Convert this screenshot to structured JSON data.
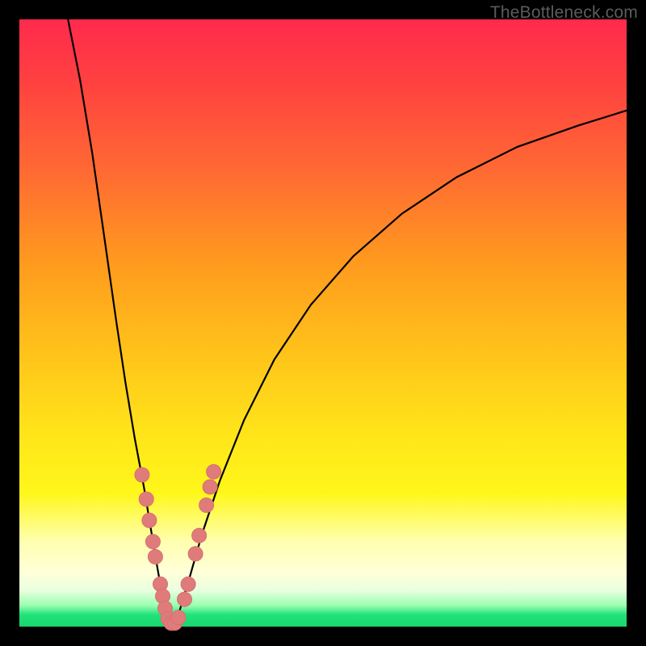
{
  "watermark": "TheBottleneck.com",
  "colors": {
    "frame": "#000000",
    "curve": "#000000",
    "marker_fill": "#e07b7b",
    "marker_stroke": "#d86f6f"
  },
  "chart_data": {
    "type": "line",
    "title": "",
    "xlabel": "",
    "ylabel": "",
    "xlim": [
      0,
      100
    ],
    "ylim": [
      0,
      100
    ],
    "grid": false,
    "legend": false,
    "series": [
      {
        "name": "left-branch",
        "x": [
          8,
          10,
          12,
          14,
          16,
          17.5,
          19,
          20.5,
          21.5,
          22.5,
          23.2,
          23.8,
          24.3,
          24.8
        ],
        "y": [
          100,
          90,
          78,
          64,
          50,
          40,
          31,
          23,
          17,
          11,
          7,
          4,
          2,
          0
        ]
      },
      {
        "name": "right-branch",
        "x": [
          25.6,
          26.5,
          28,
          30,
          33,
          37,
          42,
          48,
          55,
          63,
          72,
          82,
          92,
          100
        ],
        "y": [
          0,
          3,
          8,
          15,
          24,
          34,
          44,
          53,
          61,
          68,
          74,
          79,
          82.5,
          85
        ]
      }
    ],
    "markers": {
      "name": "highlight-points",
      "points": [
        {
          "x": 20.2,
          "y": 25
        },
        {
          "x": 20.9,
          "y": 21
        },
        {
          "x": 21.4,
          "y": 17.5
        },
        {
          "x": 22.0,
          "y": 14
        },
        {
          "x": 22.4,
          "y": 11.5
        },
        {
          "x": 23.2,
          "y": 7
        },
        {
          "x": 23.6,
          "y": 5
        },
        {
          "x": 24.0,
          "y": 3
        },
        {
          "x": 24.5,
          "y": 1.3
        },
        {
          "x": 25.0,
          "y": 0.6
        },
        {
          "x": 25.6,
          "y": 0.6
        },
        {
          "x": 26.2,
          "y": 1.5
        },
        {
          "x": 27.2,
          "y": 4.5
        },
        {
          "x": 27.8,
          "y": 7
        },
        {
          "x": 29.0,
          "y": 12
        },
        {
          "x": 29.6,
          "y": 15
        },
        {
          "x": 30.8,
          "y": 20
        },
        {
          "x": 31.4,
          "y": 23
        },
        {
          "x": 32.0,
          "y": 25.5
        }
      ]
    }
  }
}
